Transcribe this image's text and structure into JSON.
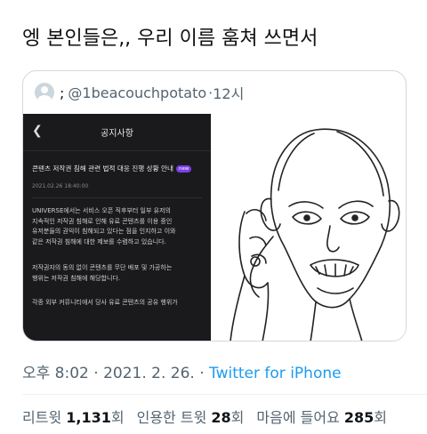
{
  "tweet": {
    "text": "엥 본인들은,, 우리 이름 훔쳐 쓰면서"
  },
  "quote": {
    "name": ";",
    "handle": "@1beacouchpotato",
    "separator": "·",
    "time": "12시",
    "screenshot": {
      "nav_title": "공지사항",
      "notice_title": "콘텐츠 저작권 침해 관련 법적 대응 진행 상황 안내",
      "badge": "new",
      "date": "2021.02.26 18:40:00",
      "paragraph1": "UNIVERSE에서는 서비스 오픈 직후부터 일부 유저의\n지속적인 저작권 침해로 인해 유료 콘텐츠를 이용 중인\n유저분들의 권익이 침해되고 있다는 점을 인지하고 이와\n같은 저작권 침해에 대한 제보를 수렴하고 있습니다.",
      "paragraph2": "저작권자의 동의 없이 콘텐츠를 무단 배포 및 가공하는\n행위는 저작권 침해에 해당합니다.",
      "paragraph3": "각종 외부 커뮤니티에서 당사 유료 콘텐츠의 공유 행위가"
    }
  },
  "meta": {
    "time": "오후 8:02",
    "dot1": "·",
    "date": "2021. 2. 26.",
    "dot2": "·",
    "source": "Twitter for iPhone"
  },
  "stats": {
    "retweets_label": "리트윗",
    "retweets_count": "1,131",
    "retweets_unit": "회",
    "quotes_label": "인용한 트윗",
    "quotes_count": "28",
    "quotes_unit": "회",
    "likes_label": "마음에 들어요",
    "likes_count": "285",
    "likes_unit": "회"
  },
  "colors": {
    "link": "#1d9bf0",
    "secondary": "#536471",
    "badge": "#7b3fe4",
    "phone_bg": "#1a1a1c"
  },
  "icons": {
    "avatar": "default-avatar-icon",
    "back": "chevron-left-icon"
  }
}
